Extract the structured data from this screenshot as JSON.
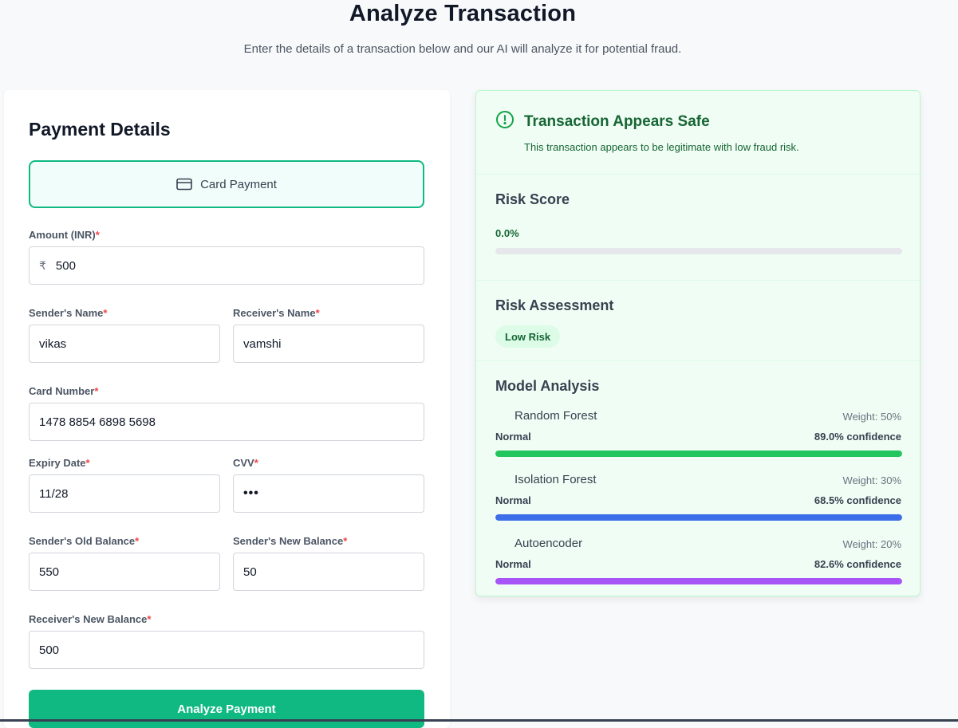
{
  "header": {
    "title": "Analyze Transaction",
    "subtitle": "Enter the details of a transaction below and our AI will analyze it for potential fraud."
  },
  "form": {
    "title": "Payment Details",
    "payment_method": {
      "label": "Card Payment",
      "icon": "credit-card-icon"
    },
    "required_marker": "*",
    "amount": {
      "label": "Amount (INR)",
      "currency_symbol": "₹",
      "value": "500"
    },
    "sender_name": {
      "label": "Sender's Name",
      "value": "vikas"
    },
    "receiver_name": {
      "label": "Receiver's Name",
      "value": "vamshi"
    },
    "card_number": {
      "label": "Card Number",
      "value": "1478 8854 6898 5698"
    },
    "expiry_date": {
      "label": "Expiry Date",
      "value": "11/28"
    },
    "cvv": {
      "label": "CVV",
      "value": "•••"
    },
    "sender_old_balance": {
      "label": "Sender's Old Balance",
      "value": "550"
    },
    "sender_new_balance": {
      "label": "Sender's New Balance",
      "value": "50"
    },
    "receiver_new_balance": {
      "label": "Receiver's New Balance",
      "value": "500"
    },
    "submit_label": "Analyze Payment"
  },
  "result": {
    "alert": {
      "icon": "alert-circle-icon",
      "title": "Transaction Appears Safe",
      "description": "This transaction appears to be legitimate with low fraud risk."
    },
    "risk_score": {
      "title": "Risk Score",
      "value_text": "0.0%",
      "value": 0.0
    },
    "risk_assessment": {
      "title": "Risk Assessment",
      "badge": "Low Risk"
    },
    "model_analysis": {
      "title": "Model Analysis",
      "models": [
        {
          "name": "Random Forest",
          "weight": "Weight: 50%",
          "prediction": "Normal",
          "confidence_text": "89.0% confidence",
          "color": "#22c55e"
        },
        {
          "name": "Isolation Forest",
          "weight": "Weight: 30%",
          "prediction": "Normal",
          "confidence_text": "68.5% confidence",
          "color": "#3b6ee8"
        },
        {
          "name": "Autoencoder",
          "weight": "Weight: 20%",
          "prediction": "Normal",
          "confidence_text": "82.6% confidence",
          "color": "#a855f7"
        }
      ]
    }
  },
  "colors": {
    "primary": "#10b981",
    "safe_text": "#166534",
    "safe_bg": "#f0fdf4",
    "required": "#ef4444"
  }
}
